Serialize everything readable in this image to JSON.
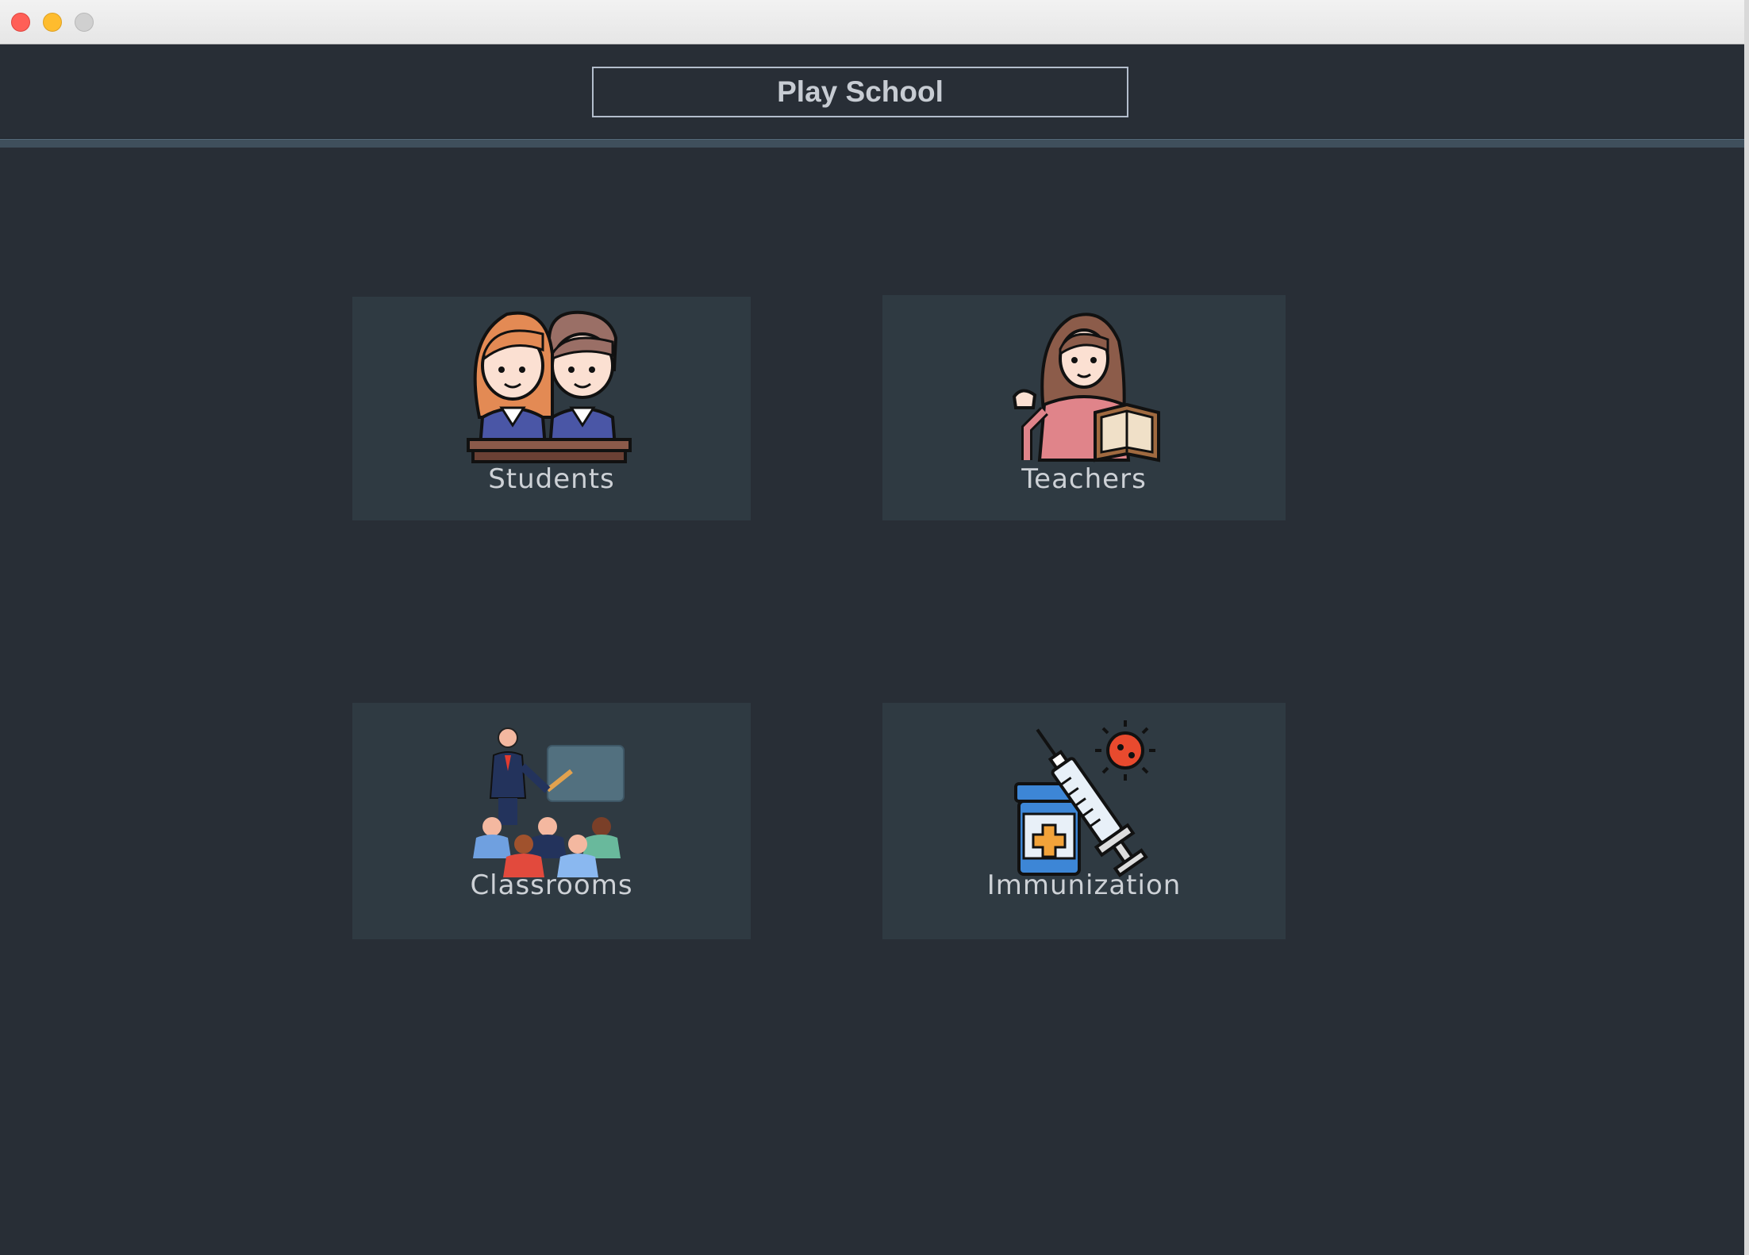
{
  "window": {
    "title": ""
  },
  "header": {
    "title": "Play School"
  },
  "tiles": [
    {
      "label": "Students",
      "icon": "students-icon"
    },
    {
      "label": "Teachers",
      "icon": "teacher-icon"
    },
    {
      "label": "Classrooms",
      "icon": "classroom-icon"
    },
    {
      "label": "Immunization",
      "icon": "vaccine-icon"
    }
  ],
  "colors": {
    "background": "#282e36",
    "tile": "#2f3a42",
    "label": "#cdd1d6",
    "title_border": "#b3bdcc"
  }
}
